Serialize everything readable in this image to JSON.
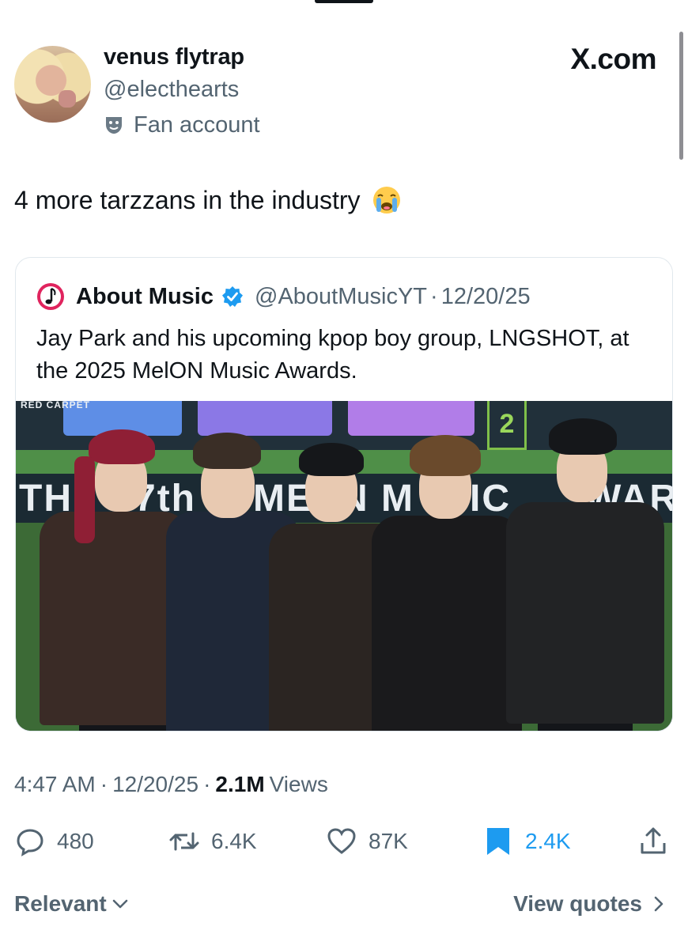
{
  "post": {
    "author_name": "venus flytrap",
    "author_handle": "@electhearts",
    "account_label": "Fan account",
    "site_brand": "X.com",
    "text": "4 more tarzzans in the industry",
    "emoji_icon": "loudly-crying-face"
  },
  "quoted": {
    "author_name": "About Music",
    "author_handle": "@AboutMusicYT",
    "date": "12/20/25",
    "separator": "·",
    "text": "Jay Park and his upcoming kpop boy group, LNGSHOT, at the 2025 MelON Music Awards.",
    "media": {
      "overlay_caption": "RED CARPET",
      "banner_lines": [
        "TH",
        "7th",
        "MEL",
        "N M",
        "SIC",
        "WAR",
        "2"
      ]
    }
  },
  "meta": {
    "time": "4:47 AM",
    "date": "12/20/25",
    "separator": "·",
    "views_count": "2.1M",
    "views_label": "Views"
  },
  "actions": {
    "replies": "480",
    "reposts": "6.4K",
    "likes": "87K",
    "bookmarks": "2.4K"
  },
  "footer": {
    "sort_label": "Relevant",
    "quotes_link": "View quotes"
  },
  "colors": {
    "accent": "#1d9bf0",
    "secondary_text": "#536471",
    "primary_text": "#0f1419",
    "border": "#e1e8ed"
  }
}
